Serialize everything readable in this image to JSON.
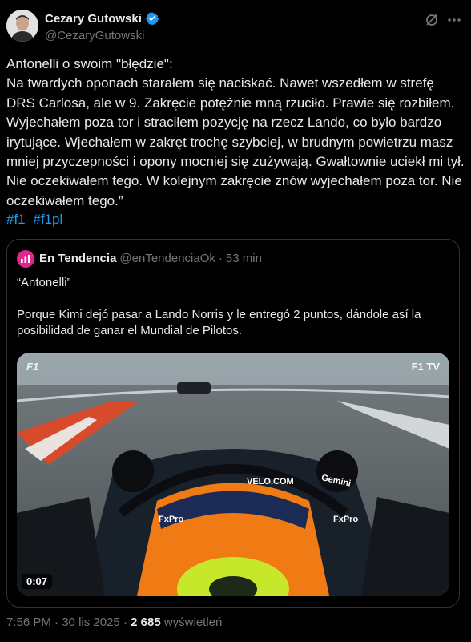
{
  "author": {
    "display_name": "Cezary Gutowski",
    "handle": "@CezaryGutowski",
    "verified": true
  },
  "tweet": {
    "text": "Antonelli o swoim \"błędzie\":\nNa twardych oponach starałem się naciskać. Nawet wszedłem w strefę DRS Carlosa, ale w 9. Zakręcie potężnie mną rzuciło. Prawie się rozbiłem. Wyjechałem poza tor i straciłem pozycję na rzecz Lando, co było bardzo irytujące. Wjechałem w zakręt trochę szybciej, w brudnym powietrzu masz mniej przyczepności i opony mocniej się zużywają. Gwałtownie uciekł mi tył. Nie oczekiwałem tego. W kolejnym zakręcie znów wyjechałem poza tor. Nie oczekiwałem tego.”",
    "hashtags": [
      "#f1",
      "#f1pl"
    ]
  },
  "quote": {
    "display_name": "En Tendencia",
    "handle": "@enTendenciaOk",
    "separator": "·",
    "time": "53 min",
    "text": "“Antonelli”\n\nPorque Kimi dejó pasar a Lando Norris y le entregó 2 puntos, dándole así la posibilidad de ganar el Mundial de Pilotos.",
    "video": {
      "duration": "0:07",
      "overlay_right": "F1 TV",
      "overlay_left": "F1",
      "car_labels": [
        "VELO.COM",
        "Gemini",
        "FxPro",
        "FxPro"
      ]
    }
  },
  "footer": {
    "time": "7:56 PM",
    "date": "30 lis 2025",
    "separator": "·",
    "views": "2 685",
    "views_label": "wyświetleń"
  },
  "colors": {
    "background": "#000000",
    "text": "#e7e9ea",
    "muted": "#71767b",
    "accent": "#1d9bf0",
    "border": "#2f3336"
  },
  "icons": {
    "verified": "verified-badge-icon",
    "grok": "grok-icon",
    "more": "more-icon"
  }
}
